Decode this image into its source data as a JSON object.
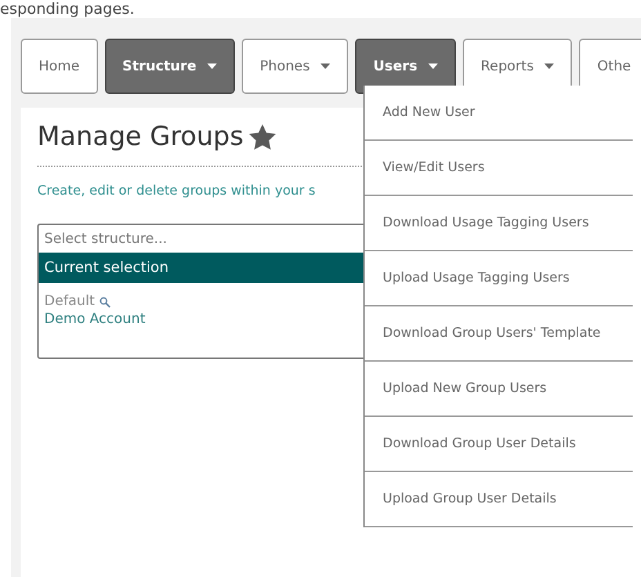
{
  "heading_fragment": "esponding pages.",
  "nav_tabs": [
    {
      "label": "Home",
      "dropdown": false,
      "selected": false
    },
    {
      "label": "Structure",
      "dropdown": true,
      "selected": true
    },
    {
      "label": "Phones",
      "dropdown": true,
      "selected": false
    },
    {
      "label": "Users",
      "dropdown": true,
      "selected": true
    },
    {
      "label": "Reports",
      "dropdown": true,
      "selected": false
    },
    {
      "label": "Othe",
      "dropdown": false,
      "selected": false
    }
  ],
  "card": {
    "title": "Manage Groups",
    "favorite": true,
    "description": "Create, edit or delete groups within your s",
    "structure_select": {
      "placeholder": "Select structure...",
      "header": "Current selection",
      "options": [
        {
          "label": "Default",
          "kind": "search"
        },
        {
          "label": "Demo Account",
          "kind": "link"
        }
      ]
    }
  },
  "users_menu": [
    "Add New User",
    "View/Edit Users",
    "Download Usage Tagging Users",
    "Upload Usage Tagging Users",
    "Download Group Users' Template",
    "Upload New Group Users",
    "Download Group User Details",
    "Upload Group User Details"
  ]
}
